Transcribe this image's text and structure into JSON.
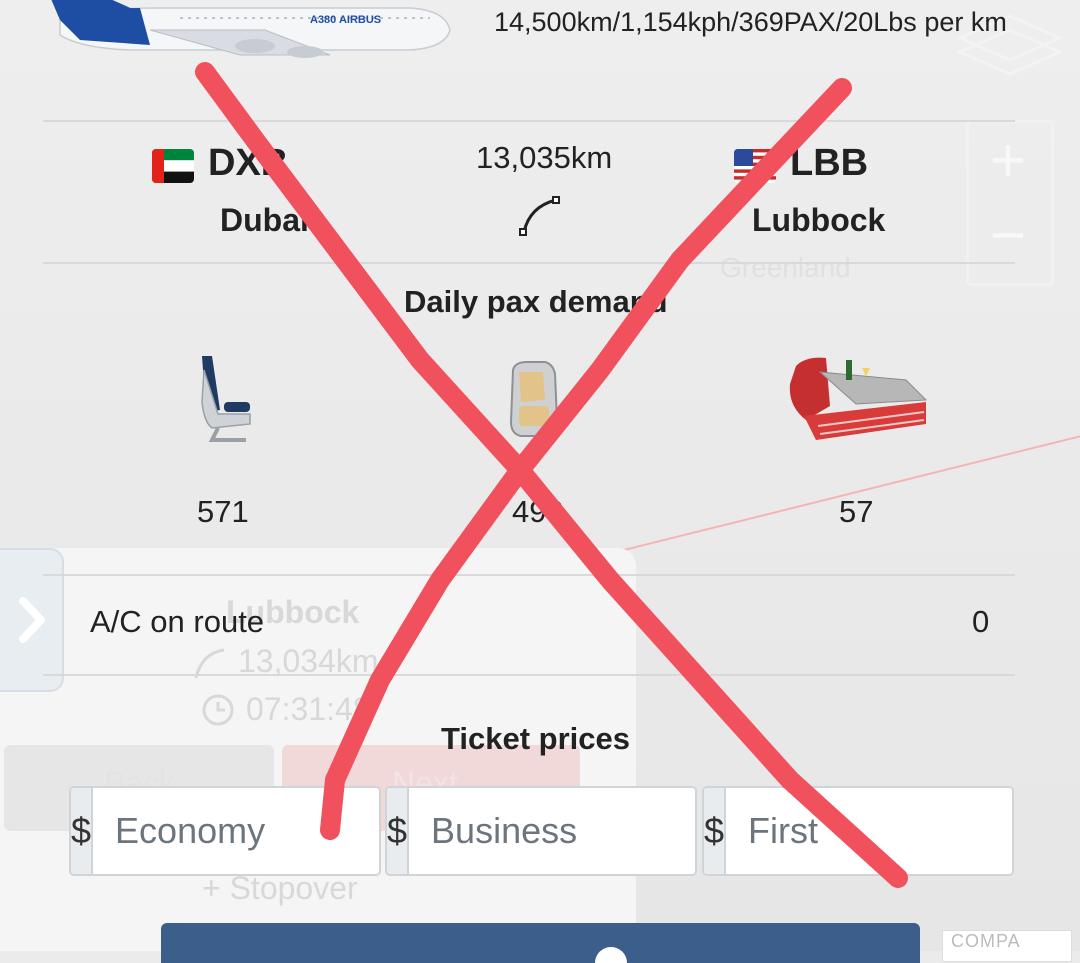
{
  "aircraft": {
    "specs": "14,500km/1,154kph/369PAX/20Lbs per km",
    "image_name": "a380-aircraft-image"
  },
  "route": {
    "origin": {
      "code": "DXB",
      "city": "Dubai",
      "flag": "uae-flag"
    },
    "destination": {
      "code": "LBB",
      "city": "Lubbock",
      "flag": "usa-flag"
    },
    "distance": "13,035km"
  },
  "demand": {
    "title": "Daily pax demand",
    "economy": "571",
    "business": "490",
    "first": "57"
  },
  "aircraft_on_route": {
    "label": "A/C on route",
    "value": "0"
  },
  "ticket_prices": {
    "title": "Ticket prices",
    "currency": "$",
    "economy_placeholder": "Economy",
    "business_placeholder": "Business",
    "first_placeholder": "First"
  },
  "background": {
    "map_label": "Greenland",
    "ghost_city": "Lubbock",
    "ghost_distance": "13,034km",
    "ghost_time": "07:31:48",
    "ghost_back": "Back",
    "ghost_next": "Next",
    "ghost_stopover": "Stopover",
    "compare_label": "COMPA"
  },
  "colors": {
    "accent": "#3b5f8a",
    "strike": "#f0515d",
    "business_seat_accent": "#e2c48a",
    "first_seat_red": "#d93a3a"
  }
}
